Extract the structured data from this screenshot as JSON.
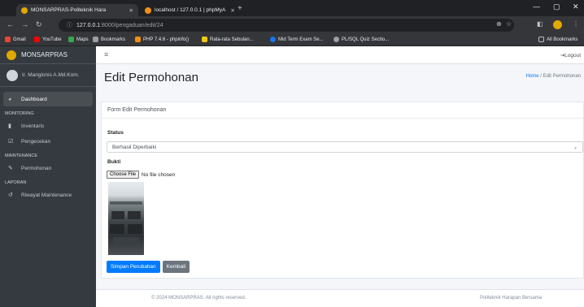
{
  "browser": {
    "tabs": [
      {
        "title": "MONSARPRAS-Politeknik Hara",
        "active": true,
        "favicon_color": "#e0a800"
      },
      {
        "title": "localhost / 127.0.0.1 | phpMyA",
        "active": false,
        "favicon_color": "#f29111"
      }
    ],
    "new_tab": "+",
    "window_controls": [
      "—",
      "▢",
      "✕"
    ],
    "url_host": "127.0.0.1",
    "url_path": ":8000/pengaduan/edit/24",
    "bookmarks": [
      {
        "label": "Gmail",
        "color": "#ea4335"
      },
      {
        "label": "YouTube",
        "color": "#ff0000"
      },
      {
        "label": "Maps",
        "color": "#34a853"
      },
      {
        "label": "Bookmarks",
        "color": "#9aa0a6"
      },
      {
        "label": "PHP 7.4.6 - phpinfo()",
        "color": "#f29111"
      },
      {
        "label": "Rata-rata Sebulan...",
        "color": "#f2c811"
      },
      {
        "label": "Mid Term Exam Se...",
        "color": "#1a73e8"
      },
      {
        "label": "PL/SQL Quiz Sectio...",
        "color": "#9aa0a6"
      }
    ],
    "all_bookmarks": "All Bookmarks"
  },
  "sidebar": {
    "brand": "MONSARPRAS",
    "user_name": "Ir. Manglonis A.Md.Kom.",
    "items": [
      {
        "label": "Dashboard",
        "icon": "dashboard-icon",
        "glyph": "◕",
        "active": true
      },
      {
        "header": "MONITORING"
      },
      {
        "label": "Inventaris",
        "icon": "inventory-icon",
        "glyph": "▮",
        "active": false
      },
      {
        "label": "Pengecekan",
        "icon": "check-icon",
        "glyph": "☑",
        "active": false
      },
      {
        "header": "MAINTENANCE"
      },
      {
        "label": "Permohonan",
        "icon": "edit-icon",
        "glyph": "✎",
        "active": false
      },
      {
        "header": "LAPORAN"
      },
      {
        "label": "Riwayat Maintenance",
        "icon": "history-icon",
        "glyph": "↺",
        "active": false
      }
    ]
  },
  "topnav": {
    "menu_glyph": "≡",
    "logout": "⇥Logout"
  },
  "header": {
    "title": "Edit Permohonan",
    "breadcrumb_home": "Home",
    "breadcrumb_sep": " / ",
    "breadcrumb_current": "Edit Permohonan"
  },
  "form": {
    "card_title": "Form Edit Permohonan",
    "status_label": "Status",
    "status_value": "Berhasil Diperbaiki",
    "proof_label": "Bukti",
    "file_button": "Choose File",
    "file_status": "No file chosen",
    "save_button": "Simpan Perubahan",
    "back_button": "Kembali"
  },
  "footer": {
    "left": "© 2024 MONSARPRAS. All rights reserved.",
    "right": "Politeknik Harapan Bersama"
  }
}
